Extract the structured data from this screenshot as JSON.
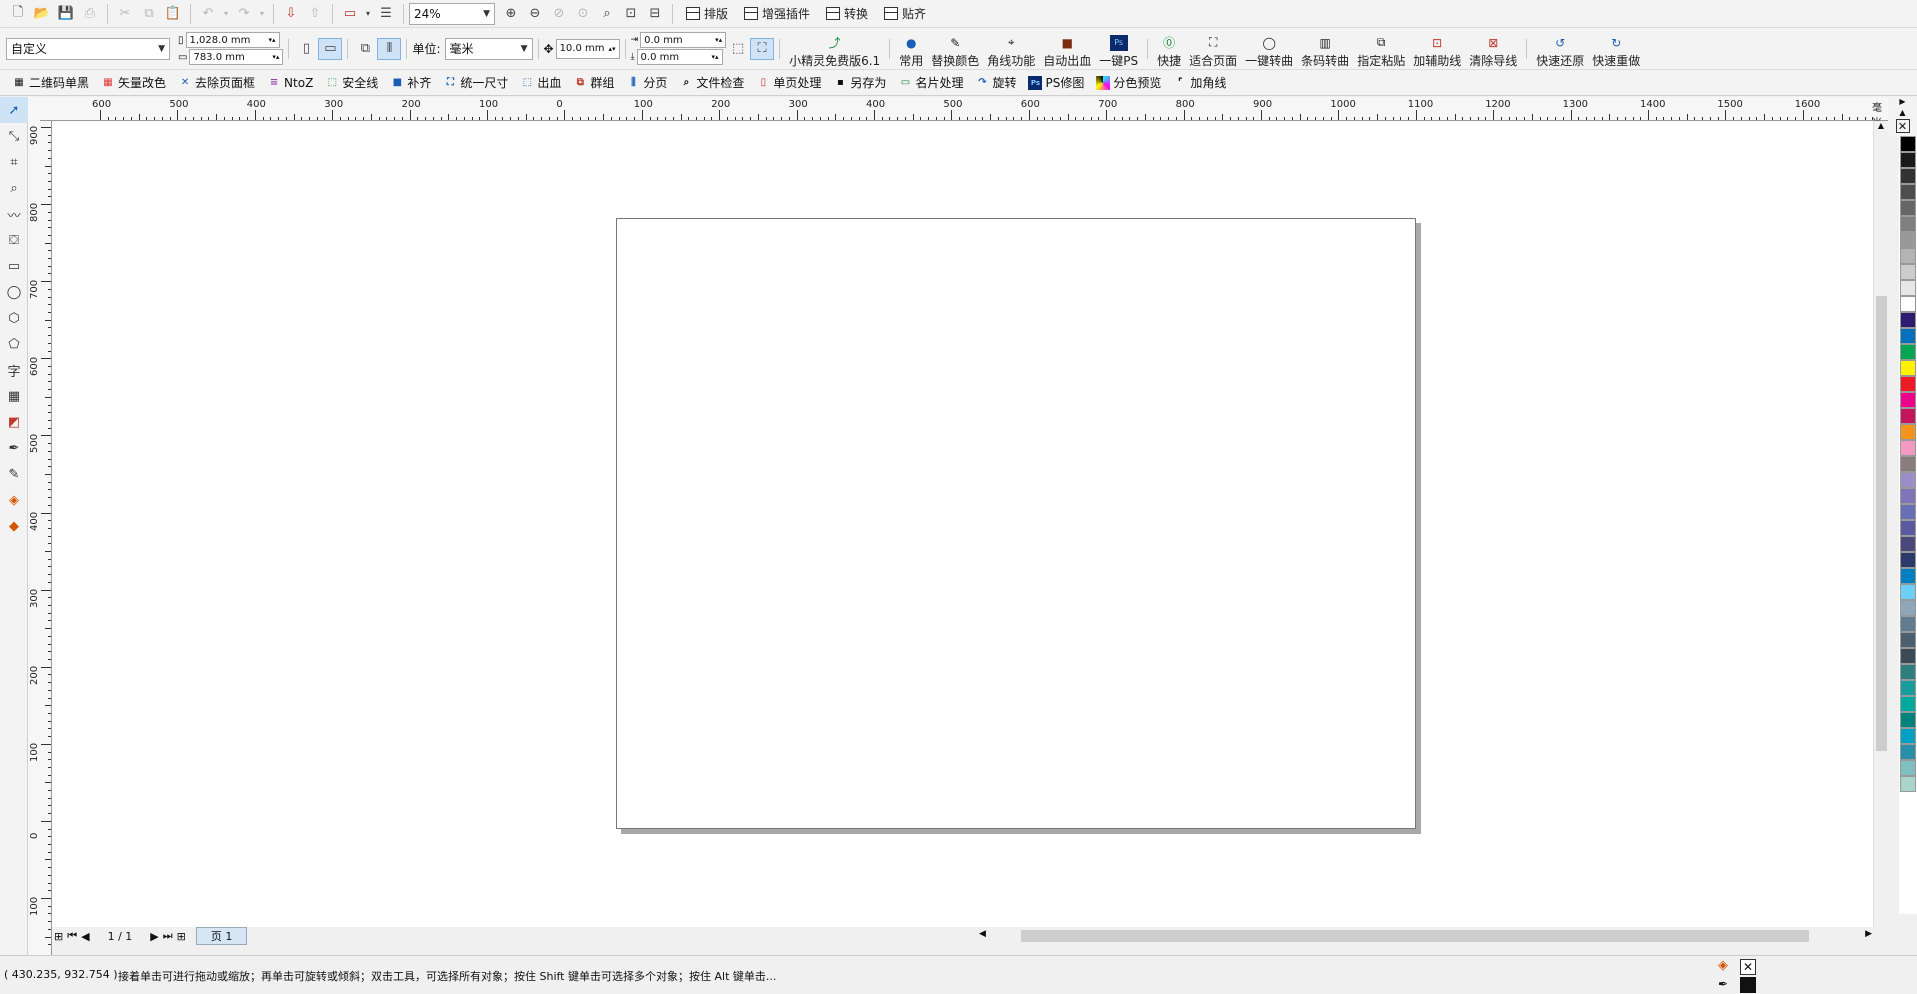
{
  "toolbar1": {
    "zoom": "24%",
    "menus": [
      "排版",
      "增强插件",
      "转换",
      "贴齐"
    ]
  },
  "toolbar2": {
    "preset": "自定义",
    "width": "1,028.0 mm",
    "height": "783.0 mm",
    "units_label": "单位:",
    "units_value": "毫米",
    "nudge": "10.0 mm",
    "dup_x": "0.0 mm",
    "dup_y": "0.0 mm",
    "plugin_buttons": [
      "小精灵免费版6.1",
      "常用",
      "替换颜色",
      "角线功能",
      "自动出血",
      "一键PS",
      "快捷",
      "适合页面",
      "一键转曲",
      "条码转曲",
      "指定粘贴",
      "加辅助线",
      "清除导线",
      "快速还原",
      "快速重做"
    ]
  },
  "toolbar3": {
    "buttons": [
      "二维码单黑",
      "矢量改色",
      "去除页面框",
      "NtoZ",
      "安全线",
      "补齐",
      "统一尺寸",
      "出血",
      "群组",
      "分页",
      "文件检查",
      "单页处理",
      "另存为",
      "名片处理",
      "旋转",
      "PS修图",
      "分色预览",
      "加角线"
    ]
  },
  "ruler_h": {
    "ticks": [
      "600",
      "500",
      "400",
      "300",
      "200",
      "100",
      "0",
      "100",
      "200",
      "300",
      "400",
      "500",
      "600",
      "700",
      "800",
      "900",
      "1000",
      "1100",
      "1200",
      "1300",
      "1400",
      "1500",
      "1600"
    ],
    "unit": "毫米"
  },
  "ruler_v": {
    "ticks": [
      "900",
      "800",
      "700",
      "600",
      "500",
      "400",
      "300",
      "200",
      "100",
      "0",
      "100"
    ]
  },
  "page_nav": {
    "count": "1 / 1",
    "tab": "页 1"
  },
  "status": {
    "coords": "( 430.235, 932.754 )",
    "hint": "接着单击可进行拖动或缩放；再单击可旋转或倾斜；双击工具，可选择所有对象；按住 Shift 键单击可选择多个对象；按住 Alt 键单击..."
  },
  "palette_colors": [
    "#000000",
    "#1a1a1a",
    "#333333",
    "#4d4d4d",
    "#666666",
    "#808080",
    "#999999",
    "#b3b3b3",
    "#cccccc",
    "#e6e6e6",
    "#ffffff",
    "#2e1a6e",
    "#0072bc",
    "#00a651",
    "#fff200",
    "#ed1c24",
    "#ec008c",
    "#c2185b",
    "#f7941d",
    "#f49ac1",
    "#8b7d7b",
    "#9e8ec6",
    "#7f74b8",
    "#6670b2",
    "#5c5a9e",
    "#4a4a7a",
    "#2b3a67",
    "#0080c0",
    "#6dcff6",
    "#8fa7b8",
    "#5f7d8e",
    "#4a5f70",
    "#3c4a55",
    "#2f7f7f",
    "#1a9c9c",
    "#00a99d",
    "#00827f",
    "#00a0c6",
    "#2a8fa8",
    "#7fbfbf",
    "#a8d5c8"
  ]
}
